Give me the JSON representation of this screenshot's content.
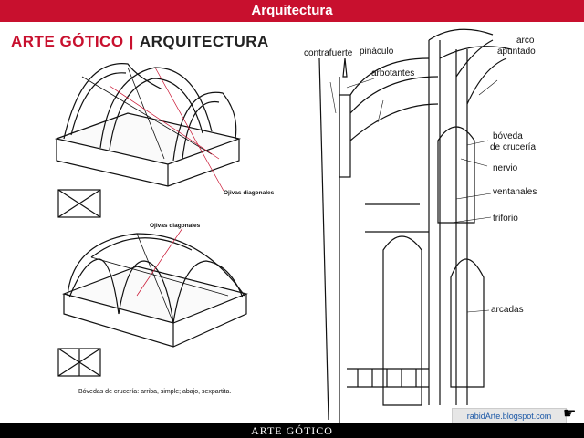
{
  "top_title": "Arquitectura",
  "bottom_title": "ARTE GÓTICO",
  "header": {
    "part1": "ARTE GÓTICO",
    "separator": "|",
    "part2": "ARQUITECTURA"
  },
  "left_labels": {
    "ojivas_1": "Ojivas diagonales",
    "ojivas_2": "Ojivas diagonales"
  },
  "caption": "Bóvedas de crucería: arriba, simple; abajo, sexpartita.",
  "right_labels": {
    "contrafuerte": "contrafuerte",
    "pinaculo": "pináculo",
    "arbotantes": "arbotantes",
    "arco_line1": "arco",
    "arco_line2": "apuntado",
    "boveda_line1": "bóveda",
    "boveda_line2": "de crucería",
    "nervio": "nervio",
    "ventanales": "ventanales",
    "triforio": "triforio",
    "arcadas": "arcadas"
  },
  "blog": "rabidArte.blogspot.com",
  "colors": {
    "red_bar": "#c8102e",
    "bottom_bar": "#000000",
    "blog_text": "#1a57a6"
  }
}
